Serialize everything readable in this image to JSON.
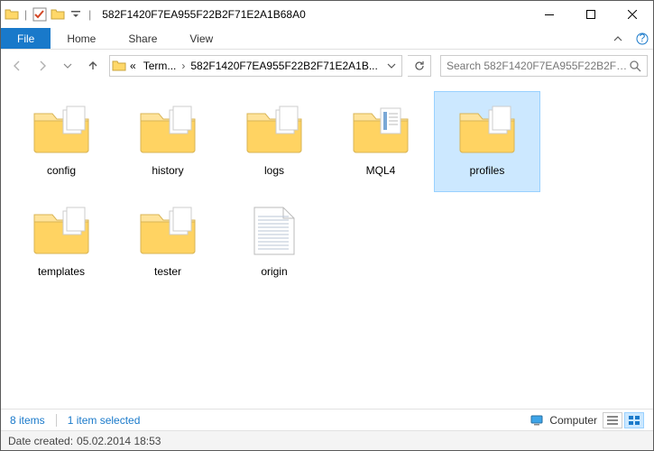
{
  "window": {
    "title": "582F1420F7EA955F22B2F71E2A1B68A0"
  },
  "ribbon": {
    "file": "File",
    "tabs": [
      "Home",
      "Share",
      "View"
    ]
  },
  "address": {
    "prefix": "«",
    "crumb1": "Term...",
    "crumb2": "582F1420F7EA955F22B2F71E2A1B..."
  },
  "search": {
    "placeholder": "Search 582F1420F7EA955F22B2F71E2..."
  },
  "items": [
    {
      "name": "config",
      "type": "folder",
      "selected": false
    },
    {
      "name": "history",
      "type": "folder",
      "selected": false
    },
    {
      "name": "logs",
      "type": "folder",
      "selected": false
    },
    {
      "name": "MQL4",
      "type": "folder-content",
      "selected": false
    },
    {
      "name": "profiles",
      "type": "folder",
      "selected": true
    },
    {
      "name": "templates",
      "type": "folder",
      "selected": false
    },
    {
      "name": "tester",
      "type": "folder",
      "selected": false
    },
    {
      "name": "origin",
      "type": "file-text",
      "selected": false
    }
  ],
  "status": {
    "count": "8 items",
    "selection": "1 item selected",
    "location_label": "Computer",
    "details_label": "Date created:",
    "details_value": "05.02.2014 18:53"
  }
}
